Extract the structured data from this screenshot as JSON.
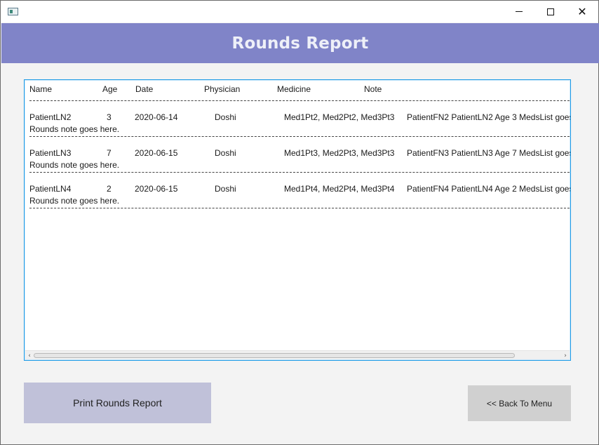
{
  "window": {
    "icon": "app-window-icon",
    "controls": {
      "minimize": "minimize-icon",
      "maximize": "maximize-icon",
      "close": "close-icon"
    }
  },
  "header": {
    "title": "Rounds Report",
    "background_color": "#8084c8"
  },
  "report": {
    "columns": {
      "name": "Name",
      "age": "Age",
      "date": "Date",
      "physician": "Physician",
      "medicine": "Medicine",
      "note": "Note"
    },
    "rows": [
      {
        "name": "PatientLN2",
        "age": "3",
        "date": "2020-06-14",
        "physician": "Doshi",
        "medicine": "Med1Pt2, Med2Pt2, Med3Pt3",
        "note": "PatientFN2 PatientLN2 Age 3 MedsList goes",
        "note_line2": "Rounds note goes here."
      },
      {
        "name": "PatientLN3",
        "age": "7",
        "date": "2020-06-15",
        "physician": "Doshi",
        "medicine": "Med1Pt3, Med2Pt3, Med3Pt3",
        "note": "PatientFN3 PatientLN3 Age 7 MedsList goes",
        "note_line2": "Rounds note goes here."
      },
      {
        "name": "PatientLN4",
        "age": "2",
        "date": "2020-06-15",
        "physician": "Doshi",
        "medicine": "Med1Pt4, Med2Pt4, Med3Pt4",
        "note": "PatientFN4 PatientLN4 Age 2 MedsList goes",
        "note_line2": "Rounds note goes here."
      }
    ],
    "focus_border_color": "#1e9be6"
  },
  "buttons": {
    "print_label": "Print Rounds Report",
    "back_label": "<< Back To Menu"
  }
}
